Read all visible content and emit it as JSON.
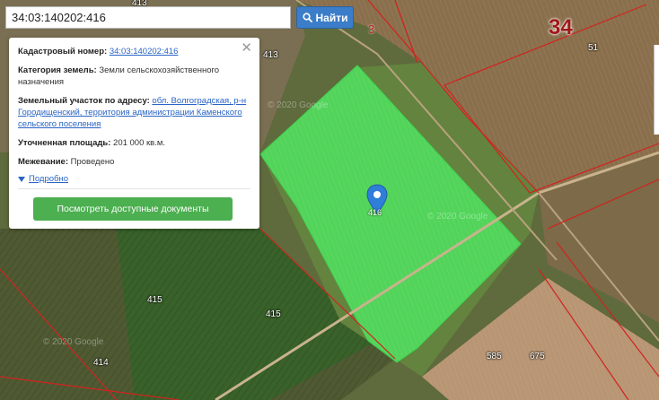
{
  "search": {
    "value": "34:03:140202:416",
    "button_label": "Найти"
  },
  "info": {
    "cadastral_label": "Кадастровый номер:",
    "cadastral_value": "34:03:140202:416",
    "category_label": "Категория земель:",
    "category_value": "Земли сельскохозяйственного назначения",
    "address_label": "Земельный участок по адресу:",
    "address_value": "обл. Волгоградская, р-н Городищенский, территория администрации Каменского сельского поселения",
    "area_label": "Уточненная площадь:",
    "area_value": "201 000 кв.м.",
    "survey_label": "Межевание:",
    "survey_value": "Проведено",
    "more_label": "Подробно",
    "docs_button": "Посмотреть доступные документы"
  },
  "map": {
    "marker_label": "416",
    "parcel_labels": [
      {
        "text": "413"
      },
      {
        "text": "415"
      },
      {
        "text": "415"
      },
      {
        "text": "414"
      },
      {
        "text": "585"
      },
      {
        "text": "675"
      },
      {
        "text": "51"
      },
      {
        "text": "3"
      },
      {
        "text": "413"
      }
    ],
    "quarter_label": "34",
    "watermark": "© 2020 Google"
  },
  "colors": {
    "parcel_fill": "#4fe35f",
    "boundary": "#d2231f",
    "accent": "#3b7dc8",
    "button_green": "#4caf50"
  }
}
